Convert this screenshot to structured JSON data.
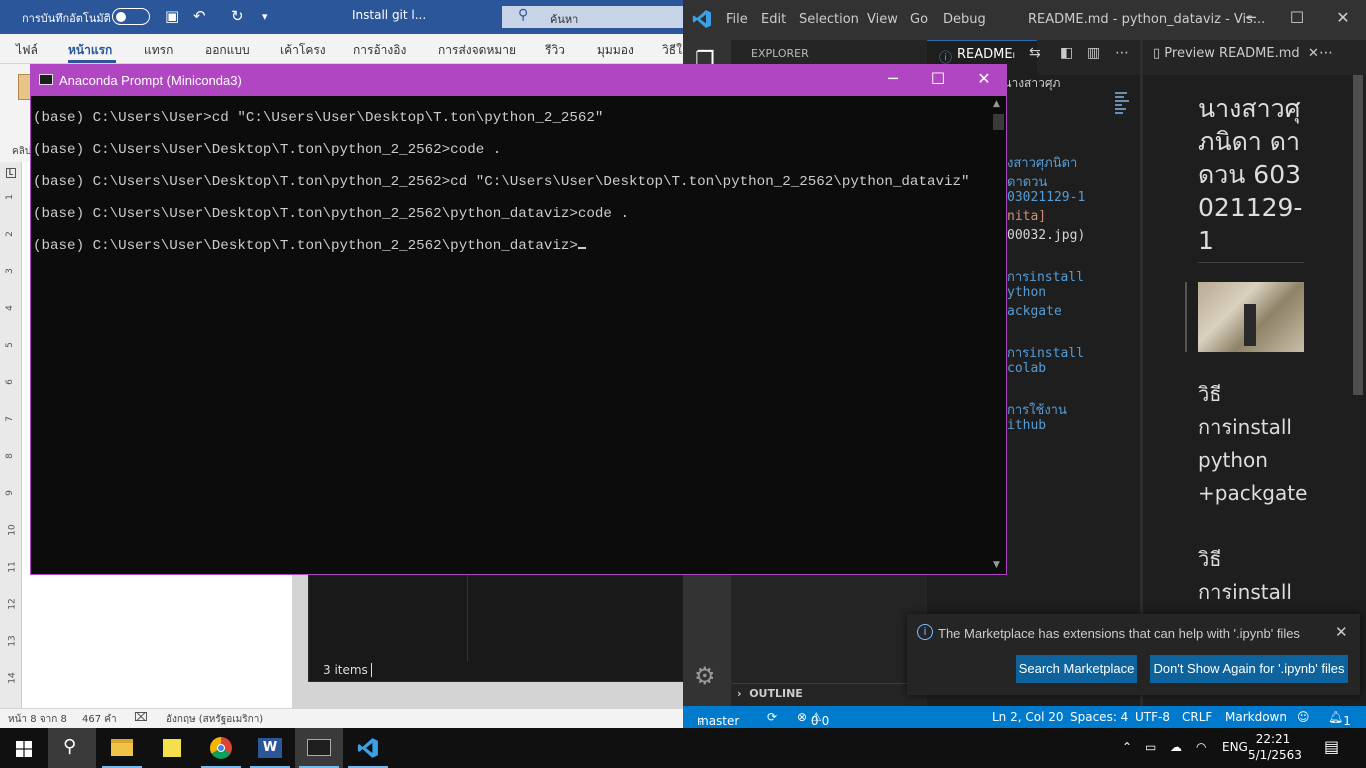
{
  "word": {
    "autosave_label": "การบันทึกอัตโนมัติ",
    "doc_title": "Install git l...",
    "search_placeholder": "ค้นหา",
    "tabs": [
      "ไฟล์",
      "หน้าแรก",
      "แทรก",
      "ออกแบบ",
      "เค้าโครง",
      "การอ้างอิง",
      "การส่งจดหมาย",
      "รีวิว",
      "มุมมอง",
      "วิธีใ"
    ],
    "clipboard_label": "คลิป",
    "ruler_marks": [
      "1",
      "2",
      "3",
      "4",
      "5",
      "6",
      "7",
      "8",
      "9",
      "10",
      "11",
      "12",
      "13",
      "14",
      "15",
      "16",
      "17",
      "18"
    ],
    "status_page": "หน้า 8 จาก 8",
    "status_words": "467 คำ",
    "status_lang": "อังกฤษ (สหรัฐอเมริกา)"
  },
  "explorer": {
    "items_count": "3 items"
  },
  "vscode": {
    "menu": [
      "File",
      "Edit",
      "Selection",
      "View",
      "Go",
      "Debug"
    ],
    "window_title": "README.md - python_dataviz - Vis...",
    "explorer_header": "EXPLORER",
    "editor_tab": "READMEₗ",
    "breadcrumb": "E.md > # นางสาวศุภ",
    "code_lines": [
      {
        "text": "งสาวศุภนิดา",
        "color": "#569cd6"
      },
      {
        "text": "ดาดวน",
        "color": "#569cd6"
      },
      {
        "text": "03021129-1",
        "color": "#569cd6"
      },
      {
        "text": "nita]",
        "color": "#ce9178"
      },
      {
        "text": "00032.jpg)",
        "color": "#d4d4d4"
      },
      {
        "text": "",
        "color": "#d4d4d4"
      },
      {
        "text": "การinstall",
        "color": "#569cd6"
      },
      {
        "text": "ython",
        "color": "#569cd6"
      },
      {
        "text": "ackgate",
        "color": "#569cd6"
      },
      {
        "text": "",
        "color": "#d4d4d4"
      },
      {
        "text": "การinstall",
        "color": "#569cd6"
      },
      {
        "text": "colab",
        "color": "#569cd6"
      },
      {
        "text": "",
        "color": "#d4d4d4"
      },
      {
        "text": "การใช้งาน",
        "color": "#569cd6"
      },
      {
        "text": "ithub",
        "color": "#569cd6"
      }
    ],
    "preview_tab": "Preview README.md",
    "preview_heading": "นางสาวศุภนิดา ดาดวน 603021129-1",
    "preview_sections": [
      "วิธี",
      "การinstall",
      "python",
      "+packgate",
      "",
      "วิธี",
      "การinstall",
      "colab"
    ],
    "outline_label": "OUTLINE",
    "status": {
      "branch": "master",
      "errors": "0",
      "warnings": "0",
      "position": "Ln 2, Col 20",
      "spaces": "Spaces: 4",
      "encoding": "UTF-8",
      "eol": "CRLF",
      "language": "Markdown",
      "notifications": "1"
    },
    "notification": {
      "message": "The Marketplace has extensions that can help with '.ipynb' files",
      "primary_button": "Search Marketplace",
      "secondary_button": "Don't Show Again for '.ipynb' files"
    }
  },
  "prompt": {
    "title": "Anaconda Prompt (Miniconda3)",
    "lines": [
      "(base) C:\\Users\\User>cd \"C:\\Users\\User\\Desktop\\T.ton\\python_2_2562\"",
      "(base) C:\\Users\\User\\Desktop\\T.ton\\python_2_2562>code .",
      "(base) C:\\Users\\User\\Desktop\\T.ton\\python_2_2562>cd \"C:\\Users\\User\\Desktop\\T.ton\\python_2_2562\\python_dataviz\"",
      "(base) C:\\Users\\User\\Desktop\\T.ton\\python_2_2562\\python_dataviz>code .",
      "(base) C:\\Users\\User\\Desktop\\T.ton\\python_2_2562\\python_dataviz>"
    ]
  },
  "taskbar": {
    "apps": [
      "start-icon",
      "search-icon",
      "file-explorer-icon",
      "sticky-notes-icon",
      "chrome-icon",
      "word-icon",
      "terminal-icon",
      "vscode-icon"
    ],
    "language": "ENG",
    "time": "22:21",
    "date": "5/1/2563"
  }
}
